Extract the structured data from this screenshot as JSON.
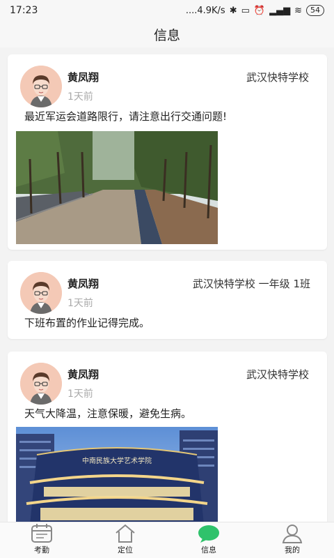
{
  "status": {
    "time": "17:23",
    "network": "....4.9K/s",
    "battery": "54"
  },
  "header": {
    "title": "信息"
  },
  "posts": [
    {
      "name": "黄凤翔",
      "school": "武汉快特学校",
      "time": "1天前",
      "content": "最近军运会道路限行，请注意出行交通问题!"
    },
    {
      "name": "黄凤翔",
      "school": "武汉快特学校 一年级 1班",
      "time": "1天前",
      "content": "下班布置的作业记得完成。"
    },
    {
      "name": "黄凤翔",
      "school": "武汉快特学校",
      "time": "1天前",
      "content": "天气大降温，注意保暖，避免生病。",
      "photo_sign": "中南民族大学艺术学院"
    }
  ],
  "tabs": [
    {
      "label": "考勤",
      "icon": "calendar-icon"
    },
    {
      "label": "定位",
      "icon": "home-icon"
    },
    {
      "label": "信息",
      "icon": "chat-bubble-icon",
      "active": true,
      "color": "#2fc26b"
    },
    {
      "label": "我的",
      "icon": "person-icon"
    }
  ]
}
